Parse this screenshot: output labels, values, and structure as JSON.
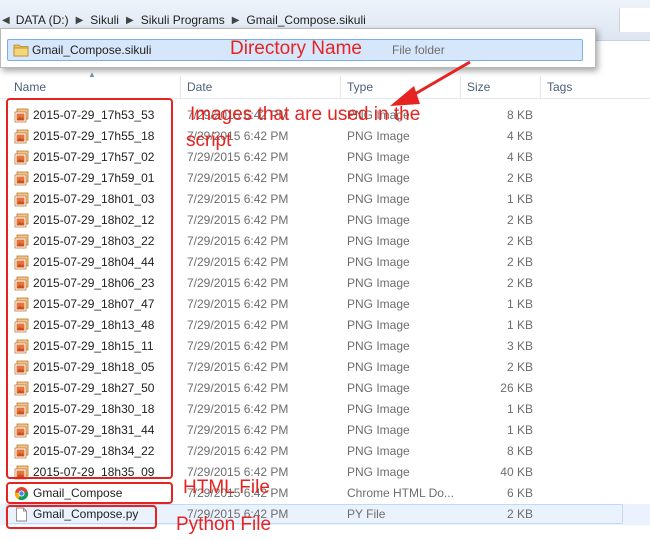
{
  "breadcrumb": [
    "DATA (D:)",
    "Sikuli",
    "Sikuli Programs",
    "Gmail_Compose.sikuli"
  ],
  "columns": {
    "name": "Name",
    "date": "Date",
    "type": "Type",
    "size": "Size",
    "tags": "Tags"
  },
  "popup": {
    "name": "Gmail_Compose.sikuli",
    "type": "File folder"
  },
  "files": [
    {
      "name": "2015-07-29_17h53_53",
      "date": "7/29/2015 6:42 PM",
      "type": "PNG Image",
      "size": "8 KB"
    },
    {
      "name": "2015-07-29_17h55_18",
      "date": "7/29/2015 6:42 PM",
      "type": "PNG Image",
      "size": "4 KB"
    },
    {
      "name": "2015-07-29_17h57_02",
      "date": "7/29/2015 6:42 PM",
      "type": "PNG Image",
      "size": "4 KB"
    },
    {
      "name": "2015-07-29_17h59_01",
      "date": "7/29/2015 6:42 PM",
      "type": "PNG Image",
      "size": "2 KB"
    },
    {
      "name": "2015-07-29_18h01_03",
      "date": "7/29/2015 6:42 PM",
      "type": "PNG Image",
      "size": "1 KB"
    },
    {
      "name": "2015-07-29_18h02_12",
      "date": "7/29/2015 6:42 PM",
      "type": "PNG Image",
      "size": "2 KB"
    },
    {
      "name": "2015-07-29_18h03_22",
      "date": "7/29/2015 6:42 PM",
      "type": "PNG Image",
      "size": "2 KB"
    },
    {
      "name": "2015-07-29_18h04_44",
      "date": "7/29/2015 6:42 PM",
      "type": "PNG Image",
      "size": "2 KB"
    },
    {
      "name": "2015-07-29_18h06_23",
      "date": "7/29/2015 6:42 PM",
      "type": "PNG Image",
      "size": "2 KB"
    },
    {
      "name": "2015-07-29_18h07_47",
      "date": "7/29/2015 6:42 PM",
      "type": "PNG Image",
      "size": "1 KB"
    },
    {
      "name": "2015-07-29_18h13_48",
      "date": "7/29/2015 6:42 PM",
      "type": "PNG Image",
      "size": "1 KB"
    },
    {
      "name": "2015-07-29_18h15_11",
      "date": "7/29/2015 6:42 PM",
      "type": "PNG Image",
      "size": "3 KB"
    },
    {
      "name": "2015-07-29_18h18_05",
      "date": "7/29/2015 6:42 PM",
      "type": "PNG Image",
      "size": "2 KB"
    },
    {
      "name": "2015-07-29_18h27_50",
      "date": "7/29/2015 6:42 PM",
      "type": "PNG Image",
      "size": "26 KB"
    },
    {
      "name": "2015-07-29_18h30_18",
      "date": "7/29/2015 6:42 PM",
      "type": "PNG Image",
      "size": "1 KB"
    },
    {
      "name": "2015-07-29_18h31_44",
      "date": "7/29/2015 6:42 PM",
      "type": "PNG Image",
      "size": "1 KB"
    },
    {
      "name": "2015-07-29_18h34_22",
      "date": "7/29/2015 6:42 PM",
      "type": "PNG Image",
      "size": "8 KB"
    },
    {
      "name": "2015-07-29_18h35_09",
      "date": "7/29/2015 6:42 PM",
      "type": "PNG Image",
      "size": "40 KB"
    },
    {
      "name": "Gmail_Compose",
      "date": "7/29/2015 6:42 PM",
      "type": "Chrome HTML Do...",
      "size": "6 KB",
      "icon": "chrome"
    },
    {
      "name": "Gmail_Compose.py",
      "date": "7/29/2015 6:42 PM",
      "type": "PY File",
      "size": "2 KB",
      "icon": "file",
      "selected": true
    }
  ],
  "annotations": {
    "directory": "Directory Name",
    "images_line1": "Images that are used in the",
    "images_line2": "script",
    "html": "HTML File",
    "python": "Python  File"
  },
  "colors": {
    "annotation": "#e52421",
    "selection": "#eaf2fd",
    "header_text": "#4c607a"
  }
}
